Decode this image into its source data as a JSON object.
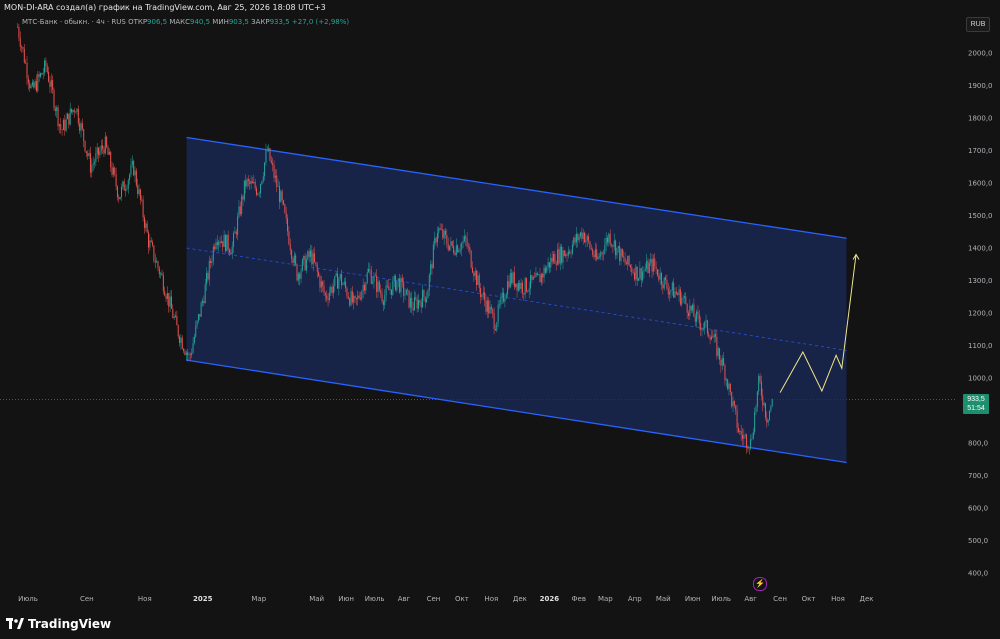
{
  "header": {
    "title": "MON-DI-ARA создал(а) график на TradingView.com, Авг 25, 2026 18:08 UTC+3"
  },
  "legend": {
    "symbol": "МТС-Банк · обыкн. · 4ч · RUS",
    "open_label": "ОТКР",
    "open_value": "906,5",
    "high_label": "МАКС",
    "high_value": "940,5",
    "low_label": "МИН",
    "low_value": "903,5",
    "close_label": "ЗАКР",
    "close_value": "933,5",
    "change": "+27,0 (+2,98%)"
  },
  "currency": "RUB",
  "price_tag": {
    "price": "933,5",
    "countdown": "51:54"
  },
  "price_axis": [
    "2000,0",
    "1900,0",
    "1800,0",
    "1700,0",
    "1600,0",
    "1500,0",
    "1400,0",
    "1300,0",
    "1200,0",
    "1100,0",
    "1000,0",
    "800,0",
    "700,0",
    "600,0",
    "500,0",
    "400,0"
  ],
  "time_axis": [
    "Июль",
    "Сен",
    "Ноя",
    "2025",
    "Мар",
    "Май",
    "Июн",
    "Июль",
    "Авг",
    "Сен",
    "Окт",
    "Ноя",
    "Дек",
    "2026",
    "Фев",
    "Мар",
    "Апр",
    "Май",
    "Июн",
    "Июль",
    "Авг",
    "Сен",
    "Окт",
    "Ноя",
    "Дек"
  ],
  "bold_time_labels": [
    "2025",
    "2026"
  ],
  "logo_text": "TradingView",
  "colors": {
    "background": "#131313",
    "channel_fill": "#1a2a5a",
    "channel_line": "#2962ff",
    "up_candle": "#26a69a",
    "down_candle": "#ef5350",
    "projection": "#f0e68c",
    "last_price": "#1e8f6e"
  },
  "chart_data": {
    "type": "candlestick",
    "currency": "RUB",
    "last_price": 933.5,
    "y_range": [
      400,
      2000
    ],
    "x_range": [
      "2024-07",
      "2026-12"
    ],
    "price_path": [
      [
        "2024-06-20",
        2080
      ],
      [
        "2024-07-05",
        1880
      ],
      [
        "2024-07-20",
        1960
      ],
      [
        "2024-08-05",
        1760
      ],
      [
        "2024-08-20",
        1840
      ],
      [
        "2024-09-05",
        1650
      ],
      [
        "2024-09-20",
        1720
      ],
      [
        "2024-10-05",
        1560
      ],
      [
        "2024-10-20",
        1650
      ],
      [
        "2024-11-05",
        1420
      ],
      [
        "2024-11-20",
        1300
      ],
      [
        "2024-12-05",
        1150
      ],
      [
        "2024-12-18",
        1060
      ],
      [
        "2025-01-01",
        1240
      ],
      [
        "2025-01-15",
        1440
      ],
      [
        "2025-02-01",
        1400
      ],
      [
        "2025-02-15",
        1600
      ],
      [
        "2025-03-01",
        1580
      ],
      [
        "2025-03-10",
        1700
      ],
      [
        "2025-03-25",
        1540
      ],
      [
        "2025-04-10",
        1320
      ],
      [
        "2025-04-25",
        1380
      ],
      [
        "2025-05-10",
        1250
      ],
      [
        "2025-05-25",
        1310
      ],
      [
        "2025-06-10",
        1220
      ],
      [
        "2025-06-25",
        1330
      ],
      [
        "2025-07-10",
        1250
      ],
      [
        "2025-07-25",
        1300
      ],
      [
        "2025-08-10",
        1220
      ],
      [
        "2025-08-25",
        1260
      ],
      [
        "2025-09-05",
        1460
      ],
      [
        "2025-09-20",
        1400
      ],
      [
        "2025-10-05",
        1420
      ],
      [
        "2025-10-20",
        1270
      ],
      [
        "2025-11-05",
        1170
      ],
      [
        "2025-11-20",
        1310
      ],
      [
        "2025-12-05",
        1280
      ],
      [
        "2025-12-20",
        1300
      ],
      [
        "2026-01-05",
        1370
      ],
      [
        "2026-01-20",
        1390
      ],
      [
        "2026-02-05",
        1450
      ],
      [
        "2026-02-20",
        1360
      ],
      [
        "2026-03-05",
        1440
      ],
      [
        "2026-03-20",
        1360
      ],
      [
        "2026-04-05",
        1320
      ],
      [
        "2026-04-20",
        1350
      ],
      [
        "2026-05-05",
        1280
      ],
      [
        "2026-05-20",
        1250
      ],
      [
        "2026-06-05",
        1180
      ],
      [
        "2026-06-20",
        1140
      ],
      [
        "2026-07-05",
        1020
      ],
      [
        "2026-07-20",
        830
      ],
      [
        "2026-08-01",
        800
      ],
      [
        "2026-08-10",
        990
      ],
      [
        "2026-08-18",
        880
      ],
      [
        "2026-08-25",
        933.5
      ]
    ],
    "channel": {
      "upper": [
        [
          "2024-12-15",
          1740
        ],
        [
          "2026-11-10",
          1430
        ]
      ],
      "lower": [
        [
          "2024-12-15",
          1055
        ],
        [
          "2026-11-10",
          740
        ]
      ],
      "median": [
        [
          "2024-12-15",
          1400
        ],
        [
          "2026-11-10",
          1085
        ]
      ]
    },
    "projection": [
      [
        "2026-09-01",
        955
      ],
      [
        "2026-09-25",
        1080
      ],
      [
        "2026-10-15",
        960
      ],
      [
        "2026-10-30",
        1070
      ],
      [
        "2026-11-05",
        1030
      ],
      [
        "2026-11-20",
        1380
      ]
    ]
  }
}
